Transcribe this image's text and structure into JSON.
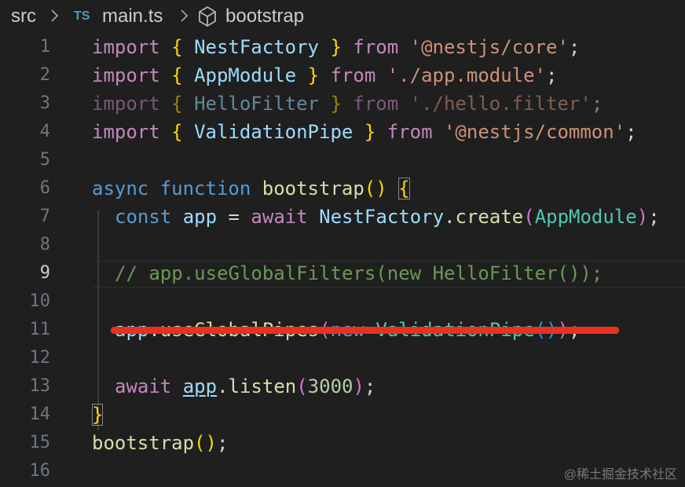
{
  "breadcrumb": {
    "folder": "src",
    "file_icon": "TS",
    "file": "main.ts",
    "symbol": "bootstrap"
  },
  "line_numbers": [
    "1",
    "2",
    "3",
    "4",
    "5",
    "6",
    "7",
    "8",
    "9",
    "10",
    "11",
    "12",
    "13",
    "14",
    "15",
    "16"
  ],
  "active_line": "9",
  "code": {
    "import_kw": "import",
    "from_kw": "from",
    "lbrace": "{",
    "rbrace": "}",
    "semi": ";",
    "nest_factory": "NestFactory",
    "core_path": "'@nestjs/core'",
    "app_module": "AppModule",
    "app_module_path": "'./app.module'",
    "hello_filter": "HelloFilter",
    "hello_filter_path": "'./hello.filter'",
    "validation_pipe": "ValidationPipe",
    "common_path": "'@nestjs/common'",
    "async_kw": "async",
    "function_kw": "function",
    "bootstrap": "bootstrap",
    "parens": "()",
    "const_kw": "const",
    "app": "app",
    "eq": "=",
    "await_kw": "await",
    "dot": ".",
    "create": "create",
    "lparen": "(",
    "rparen": ")",
    "comment_line": "// app.useGlobalFilters(new HelloFilter());",
    "use_global_pipes": "useGlobalPipes",
    "new_kw": "new",
    "listen": "listen",
    "port": "3000"
  },
  "watermark": "@稀土掘金技术社区",
  "colors": {
    "background": "#1f1f1f",
    "red_underline": "#e8321f"
  },
  "icons": {
    "breadcrumb_separator": "chevron-right-icon",
    "file_type": "typescript-file-icon",
    "symbol": "cube-method-icon"
  }
}
